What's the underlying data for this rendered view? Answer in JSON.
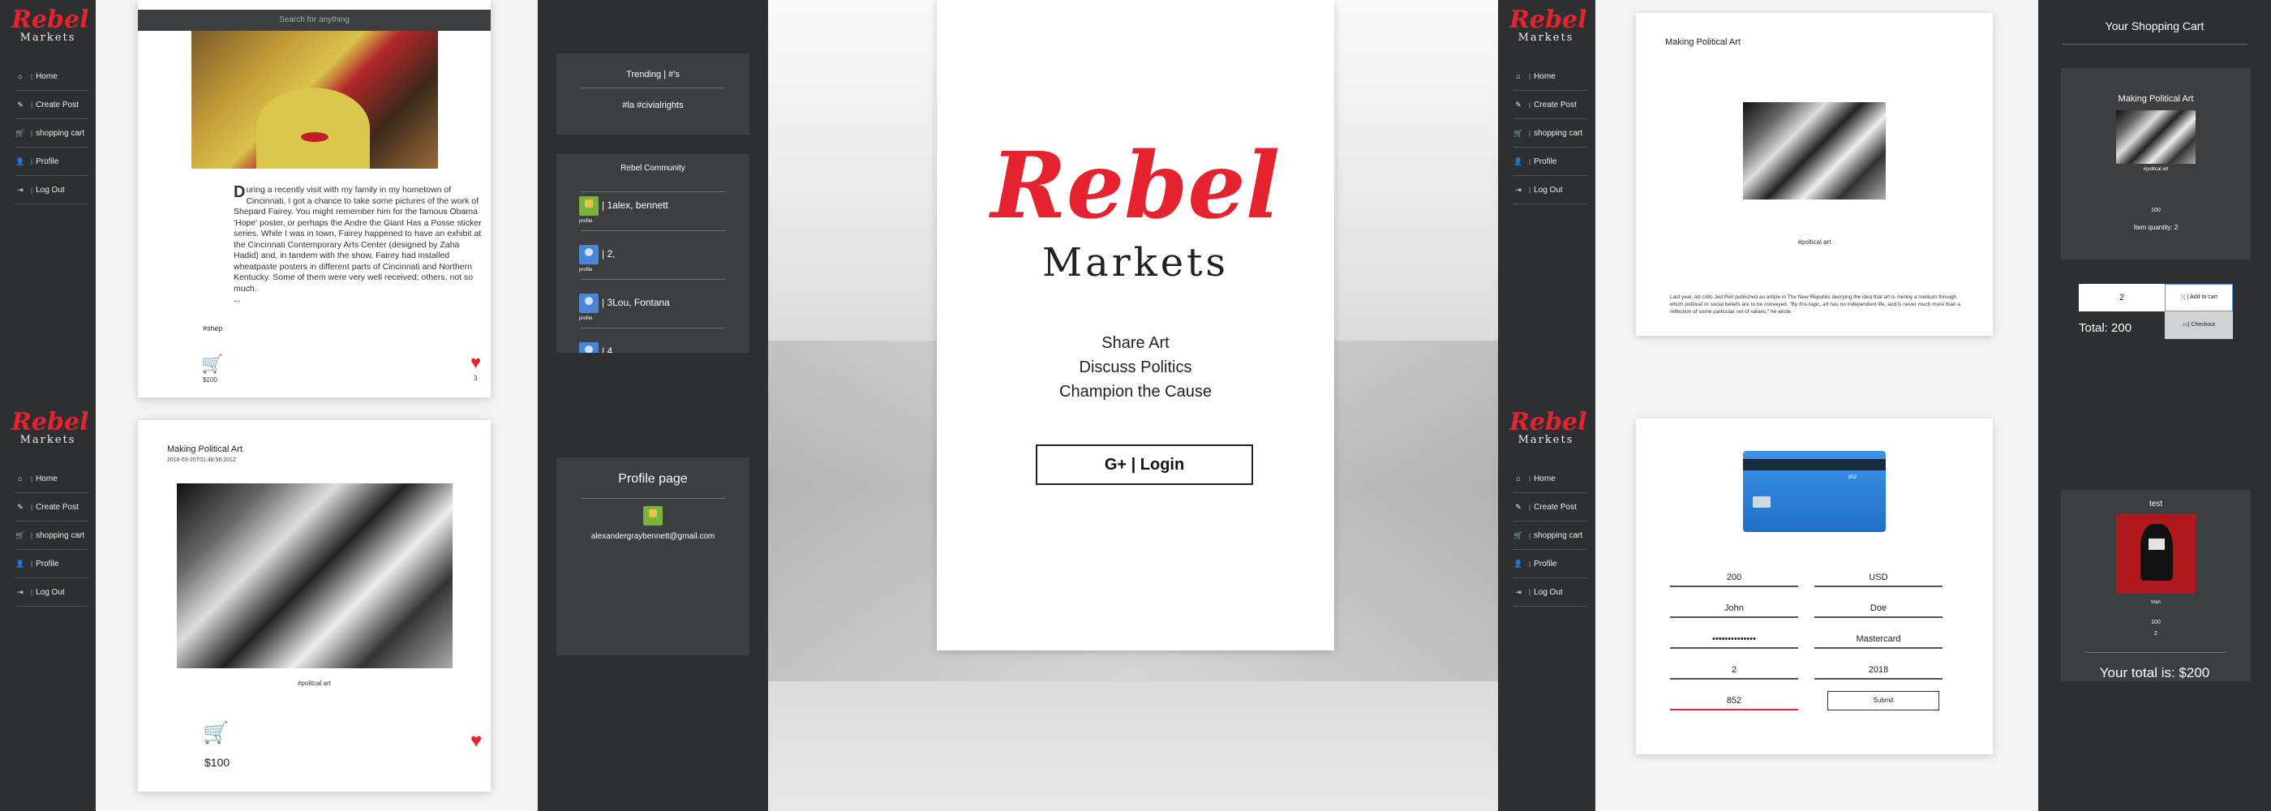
{
  "brand": {
    "rebel": "Rebel",
    "markets": "Markets",
    "accent": "#e4232f"
  },
  "nav": [
    {
      "icon": "home-icon",
      "glyph": "⌂",
      "label": "Home"
    },
    {
      "icon": "edit-icon",
      "glyph": "✎",
      "label": "Create Post"
    },
    {
      "icon": "cart-icon",
      "glyph": "🛒",
      "label": "shopping cart"
    },
    {
      "icon": "user-icon",
      "glyph": "👤",
      "label": "Profile"
    },
    {
      "icon": "logout-icon",
      "glyph": "⇥",
      "label": "Log Out"
    }
  ],
  "feed": {
    "search_placeholder": "Search for anything",
    "post1": {
      "drop_cap": "D",
      "body": "uring a recently visit with my family in my hometown of Cincinnati, I got a chance to take some pictures of the work of Shepard Fairey. You might remember him for the famous Obama 'Hope' poster, or perhaps the Andre the Giant Has a Posse sticker series. While I was in town, Fairey happened to have an exhibit at the Cincinnati Contemporary Arts Center (designed by Zaha Hadid) and, in tandem with the show, Fairey had installed wheatpaste posters in different parts of Cincinnati and Northern Kentucky. Some of them were very well received; others, not so much.",
      "ellipsis": "...",
      "tag": "#shep",
      "price": "$100",
      "likes": "3"
    },
    "post2": {
      "title": "Making Political Art",
      "date": "2016-03-25T01:48:56.201Z",
      "tag": "#politcal art",
      "price": "$100"
    }
  },
  "trending": {
    "header": "Trending | #'s",
    "tags": "#la #civialrights"
  },
  "community": {
    "header": "Rebel Community",
    "members": [
      {
        "name": "| 1alex, bennett",
        "sub": "profile"
      },
      {
        "name": "| 2,",
        "sub": "profile"
      },
      {
        "name": "| 3Lou, Fontana",
        "sub": "profile"
      },
      {
        "name": "| 4,",
        "sub": ""
      }
    ]
  },
  "profile_page": {
    "title": "Profile page",
    "email": "alexandergraybennett@gmail.com"
  },
  "login": {
    "rebel": "Rebel",
    "markets": "Markets",
    "taglines": [
      "Share Art",
      "Discuss Politics",
      "Champion the Cause"
    ],
    "button": "G+  |  Login"
  },
  "detail": {
    "title": "Making Political Art",
    "tag": "#poltical art",
    "body": "Last year, art critic Jed Perl published an article in The New Republic decrying the idea that art is merely a medium through which political or social beliefs are to be conveyed. \"By this logic, art has no independent life, and is never much more than a reflection of some particular set of values,\" he wrote."
  },
  "payment": {
    "fields": [
      "200",
      "USD",
      "John",
      "Doe",
      "••••••••••••••",
      "Mastercard",
      "2",
      "2018",
      "852"
    ],
    "submit": "Submit",
    "cvv": "852"
  },
  "cart": {
    "title": "Your Shopping Cart",
    "item_title": "Making Political Art",
    "item_tag": "#politcal art",
    "item_price": "100",
    "item_qty": "Item quantity: 2",
    "qty_value": "2",
    "add_btn": "| Add to cart",
    "checkout_btn": "| Checkout",
    "total": "Total: 200",
    "item2_title": "test",
    "item2_tag": "trian",
    "item2_price": "100",
    "item2_qty": "2",
    "grand_total": "Your total is: $200"
  }
}
